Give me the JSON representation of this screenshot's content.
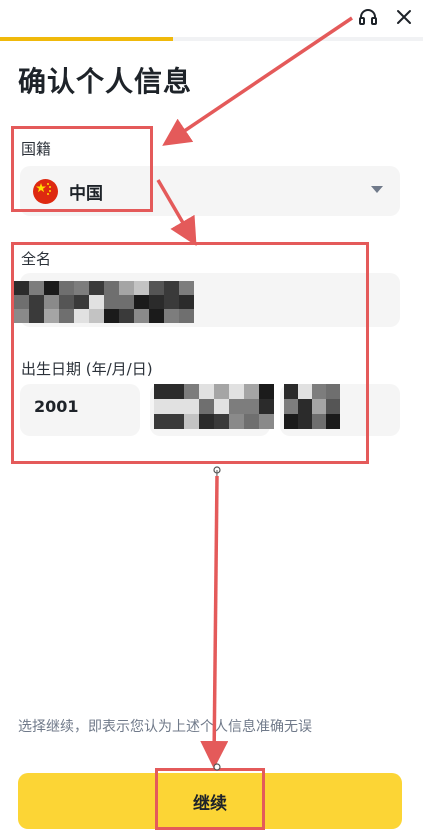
{
  "header": {
    "support_icon": "headset-icon",
    "close_icon": "close-icon",
    "progress": 0.41
  },
  "page": {
    "title": "确认个人信息"
  },
  "nationality": {
    "label": "国籍",
    "value": "中国",
    "flag_icon": "china-flag-icon"
  },
  "fullname": {
    "label": "全名"
  },
  "birthdate": {
    "label": "出生日期 (年/月/日)",
    "year": "2001"
  },
  "footer": {
    "disclaimer": "选择继续，即表示您认为上述个人信息准确无误",
    "continue_label": "继续"
  },
  "colors": {
    "accent": "#fcd535",
    "progress": "#f0b90b",
    "annotation": "#e45a5a",
    "field_bg": "#f5f5f5"
  }
}
